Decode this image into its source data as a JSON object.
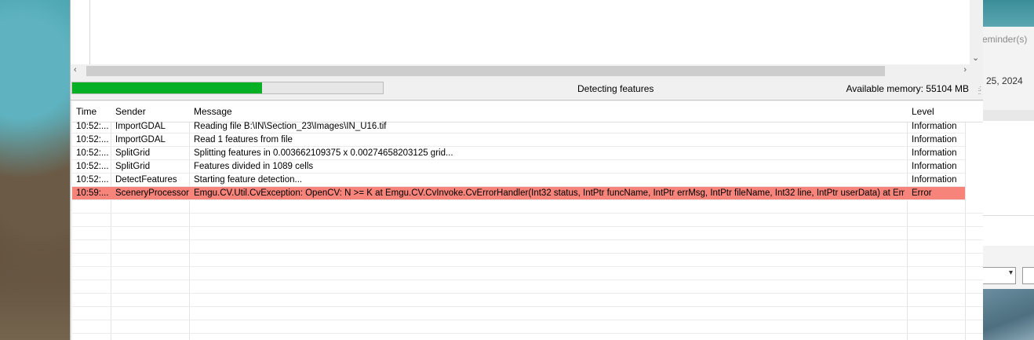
{
  "background_app": {
    "reminder_text": "eminder(s)",
    "date_text": "25, 2024"
  },
  "status": {
    "progress_percent": 61,
    "message": "Detecting features",
    "memory": "Available memory: 55104 MB"
  },
  "log": {
    "columns": [
      "Time",
      "Sender",
      "Message",
      "Level"
    ],
    "rows": [
      {
        "time": "10:52:...",
        "sender": "ImportGDAL",
        "message": "Reading file B:\\IN\\Section_23\\Images\\IN_U16.tif",
        "level": "Information"
      },
      {
        "time": "10:52:...",
        "sender": "ImportGDAL",
        "message": "Read 1 features from file",
        "level": "Information"
      },
      {
        "time": "10:52:...",
        "sender": "SplitGrid",
        "message": "Splitting features in 0.003662109375 x 0.00274658203125 grid...",
        "level": "Information"
      },
      {
        "time": "10:52:...",
        "sender": "SplitGrid",
        "message": "Features divided in 1089 cells",
        "level": "Information"
      },
      {
        "time": "10:52:...",
        "sender": "DetectFeatures",
        "message": "Starting feature detection...",
        "level": "Information"
      },
      {
        "time": "10:59:...",
        "sender": "SceneryProcessor",
        "message": "Emgu.CV.Util.CvException: OpenCV: N >= K   at Emgu.CV.CvInvoke.CvErrorHandler(Int32 status, IntPtr funcName, IntPtr errMsg, IntPtr fileName, Int32 line, IntPtr userData)   at Emgu.CV.CvI...",
        "level": "Error"
      }
    ]
  },
  "colors": {
    "error_row": "#f7847a",
    "progress_fill": "#06b025"
  }
}
